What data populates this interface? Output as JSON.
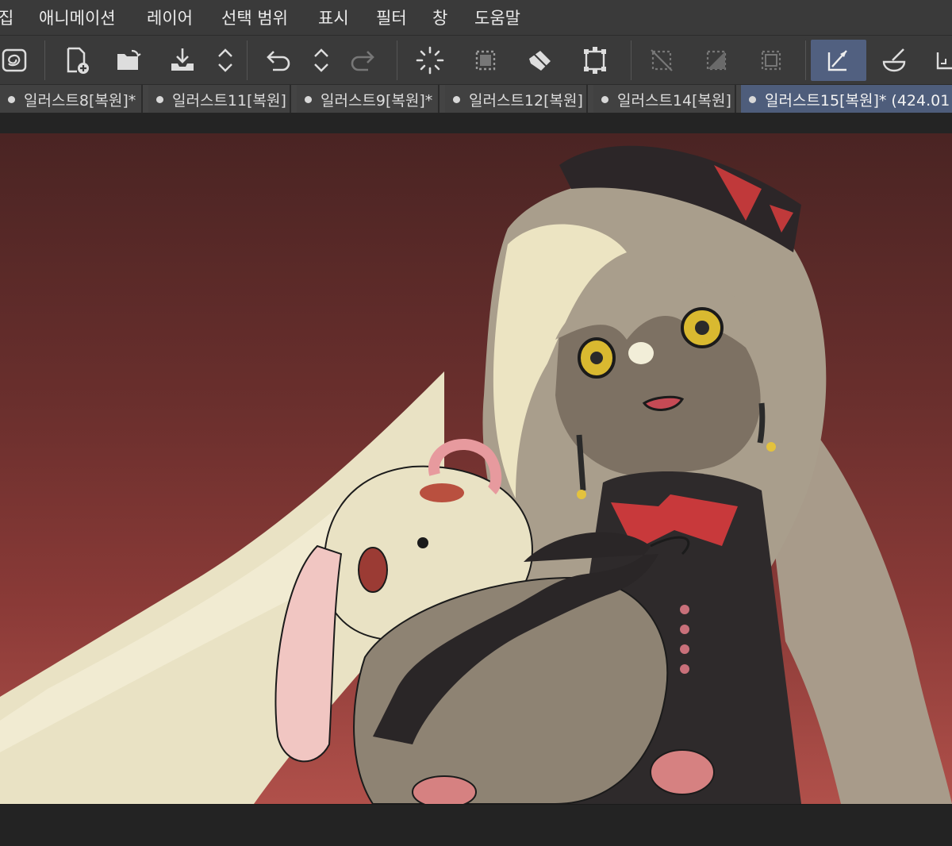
{
  "menu": [
    "집",
    "애니메이션",
    "레이어",
    "선택 범위",
    "표시",
    "필터",
    "창",
    "도움말"
  ],
  "toolbar": {
    "buttons": [
      {
        "name": "clip-studio-logo-icon"
      },
      {
        "name": "new-document-icon"
      },
      {
        "name": "open-folder-icon"
      },
      {
        "name": "save-download-icon"
      },
      {
        "name": "expand-arrows-icon"
      },
      {
        "name": "undo-icon"
      },
      {
        "name": "expand-arrows-icon"
      },
      {
        "name": "redo-icon"
      },
      {
        "name": "loading-spinner-icon"
      },
      {
        "name": "selection-marquee-icon"
      },
      {
        "name": "fill-bucket-icon"
      },
      {
        "name": "transform-icon"
      },
      {
        "name": "deselect-icon"
      },
      {
        "name": "invert-selection-icon"
      },
      {
        "name": "selection-frame-icon"
      },
      {
        "name": "ruler-pen-icon"
      },
      {
        "name": "brush-bowl-icon"
      },
      {
        "name": "snap-ruler-icon"
      }
    ],
    "active_color": "#516080"
  },
  "tabs": [
    {
      "label": "일러스트8[복원]*",
      "active": false
    },
    {
      "label": "일러스트11[복원]",
      "active": false
    },
    {
      "label": "일러스트9[복원]*",
      "active": false
    },
    {
      "label": "일러스트12[복원]",
      "active": false
    },
    {
      "label": "일러스트14[복원]",
      "active": false
    },
    {
      "label": "일러스트15[복원]* (424.01",
      "active": true
    }
  ],
  "canvas": {
    "background_gradient": [
      "#4a2423",
      "#b0504a"
    ]
  }
}
